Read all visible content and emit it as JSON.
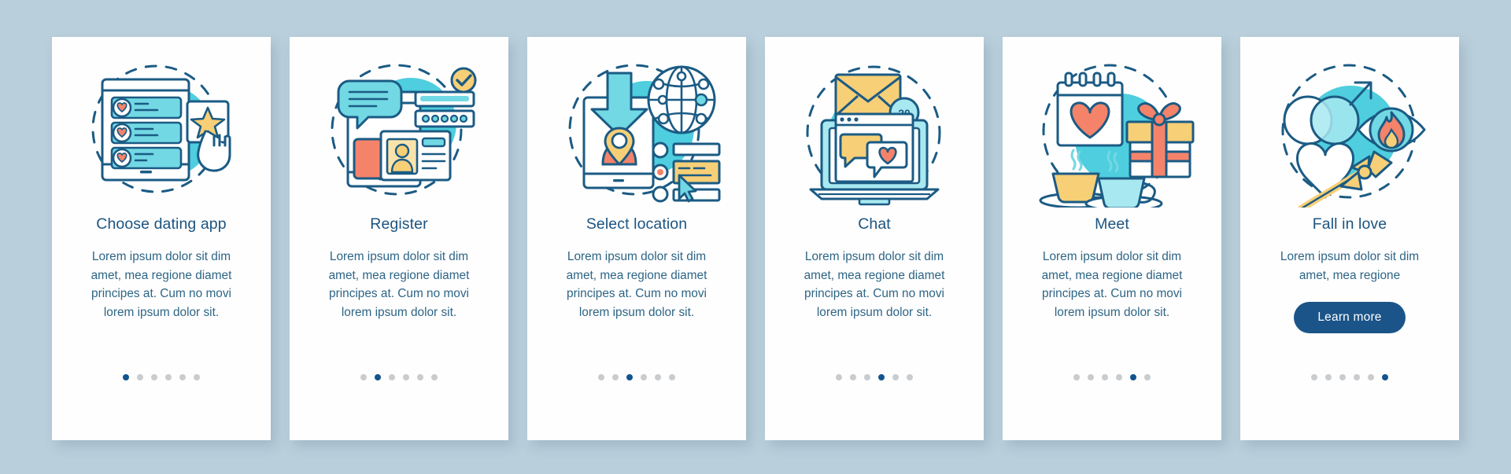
{
  "page": {
    "background_color": "#b9cfdb",
    "card_background": "#fefefe",
    "title_color": "#1c5480",
    "body_color": "#2d6585",
    "accent_color": "#13548e",
    "dot_inactive_color": "#c9ccce",
    "total_steps": 6
  },
  "cards": [
    {
      "id": "choose-dating-app",
      "title": "Choose dating app",
      "body": "Lorem ipsum dolor sit dim amet, mea regione diamet principes at. Cum no movi lorem ipsum dolor sit.",
      "illustration": "phone-heart-list-star-tap-icon",
      "active_dot": 1,
      "dots": 6,
      "button": null
    },
    {
      "id": "register",
      "title": "Register",
      "body": "Lorem ipsum dolor sit dim amet, mea regione diamet principes at. Cum no movi lorem ipsum dolor sit.",
      "illustration": "phone-chat-bubble-id-card-check-icon",
      "active_dot": 2,
      "dots": 6,
      "button": null
    },
    {
      "id": "select-location",
      "title": "Select location",
      "body": "Lorem ipsum dolor sit dim amet, mea regione diamet principes at. Cum no movi lorem ipsum dolor sit.",
      "illustration": "phone-download-map-pin-globe-icon",
      "active_dot": 3,
      "dots": 6,
      "button": null
    },
    {
      "id": "chat",
      "title": "Chat",
      "body": "Lorem ipsum dolor sit dim amet, mea regione diamet principes at. Cum no movi lorem ipsum dolor sit.",
      "illustration": "laptop-envelope-message-heart-icon",
      "badge_value": "20",
      "active_dot": 4,
      "dots": 6,
      "button": null
    },
    {
      "id": "meet",
      "title": "Meet",
      "body": "Lorem ipsum dolor sit dim amet, mea regione diamet principes at. Cum no movi lorem ipsum dolor sit.",
      "illustration": "calendar-heart-gift-coffee-cups-icon",
      "active_dot": 5,
      "dots": 6,
      "button": null
    },
    {
      "id": "fall-in-love",
      "title": "Fall in love",
      "body": "Lorem ipsum dolor sit dim amet, mea regione",
      "illustration": "gender-symbols-eye-flame-heart-arrow-icon",
      "active_dot": 6,
      "dots": 6,
      "button": "Learn more"
    }
  ]
}
